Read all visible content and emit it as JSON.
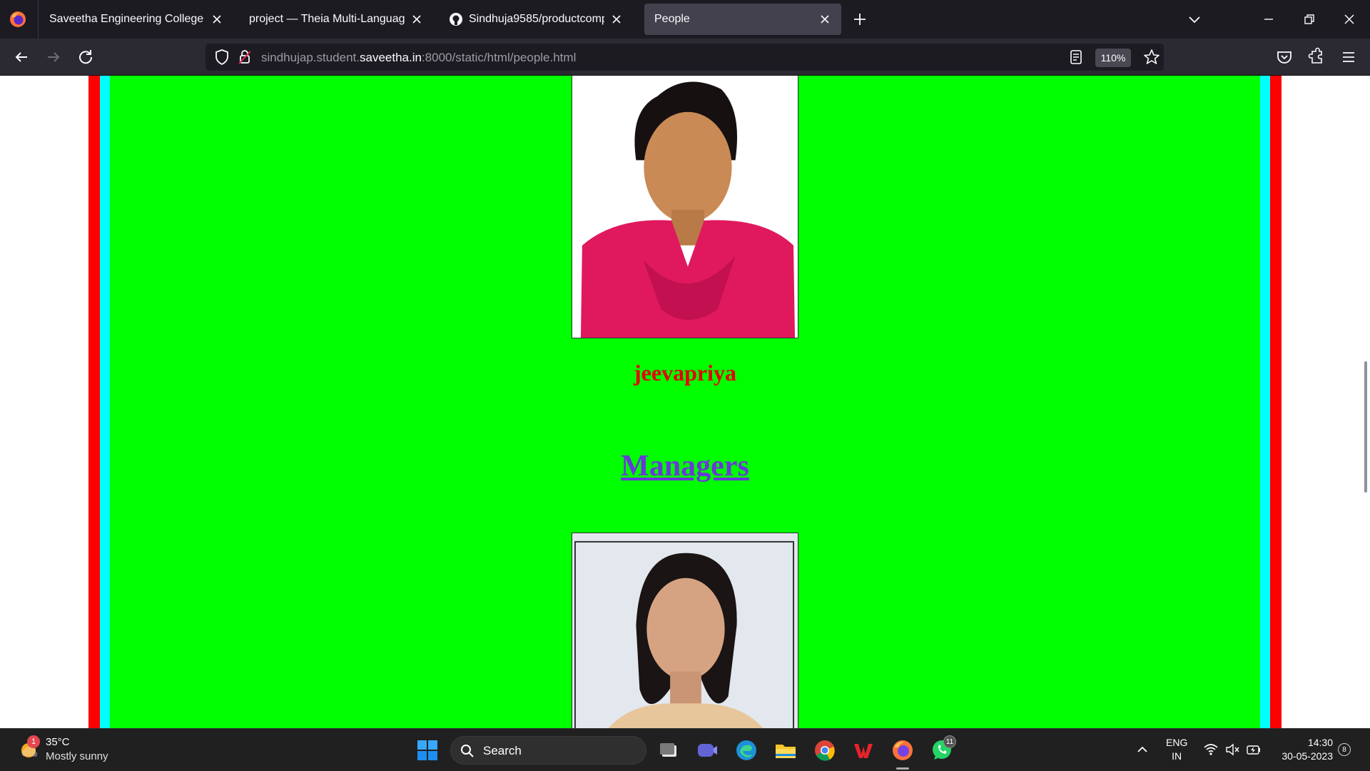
{
  "browser": {
    "tabs": [
      {
        "title": "Saveetha Engineering College",
        "active": false
      },
      {
        "title": "project — Theia Multi-Language Ex",
        "active": false
      },
      {
        "title": "Sindhuja9585/productcompany",
        "active": false
      },
      {
        "title": "People",
        "active": true
      }
    ],
    "url": {
      "prefix": "sindhujap.student.",
      "domain": "saveetha.in",
      "path": ":8000/static/html/people.html"
    },
    "zoom": "110%"
  },
  "page": {
    "person_name": "jeevapriya",
    "section_heading": "Managers",
    "colors": {
      "green": "#00ff00",
      "red": "#ff0000",
      "cyan": "#00ffff",
      "name": "#e60000",
      "heading": "#6a39d9"
    }
  },
  "taskbar": {
    "weather": {
      "temp": "35°C",
      "condition": "Mostly sunny",
      "badge": "1"
    },
    "search_label": "Search",
    "whatsapp_badge": "11",
    "lang_line1": "ENG",
    "lang_line2": "IN",
    "time": "14:30",
    "date": "30-05-2023",
    "notifications": "8"
  }
}
